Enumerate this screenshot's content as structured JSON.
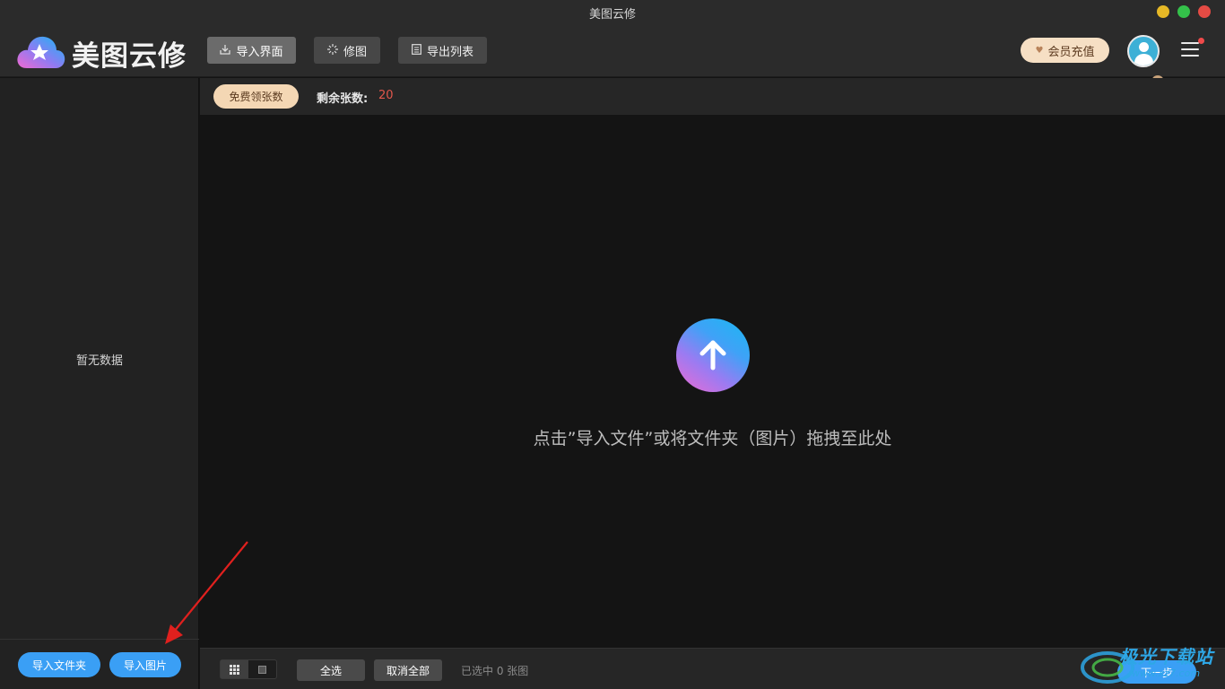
{
  "window": {
    "title": "美图云修"
  },
  "header": {
    "brand": "美图云修",
    "tabs": [
      {
        "label": "导入界面",
        "icon": "import-icon",
        "active": true
      },
      {
        "label": "修图",
        "icon": "sparkle-icon",
        "active": false
      },
      {
        "label": "导出列表",
        "icon": "list-icon",
        "active": false
      }
    ],
    "vip_label": "会员充值"
  },
  "sidebar": {
    "empty_text": "暂无数据",
    "import_folder": "导入文件夹",
    "import_image": "导入图片"
  },
  "subbar": {
    "free_label": "免费领张数",
    "remain_label": "剩余张数:",
    "remain_value": "20"
  },
  "canvas": {
    "hint": "点击”导入文件”或将文件夹（图片）拖拽至此处"
  },
  "bottombar": {
    "select_all": "全选",
    "deselect_all": "取消全部",
    "selected_info": "已选中 0 张图",
    "next": "下一步"
  },
  "watermark": {
    "text": "极光下载站",
    "url": "www.xz7.com"
  },
  "colors": {
    "accent": "#3a9ff5",
    "vip": "#f6dfc4",
    "remain_number": "#e2574c",
    "annotation_arrow": "#e0201e"
  }
}
